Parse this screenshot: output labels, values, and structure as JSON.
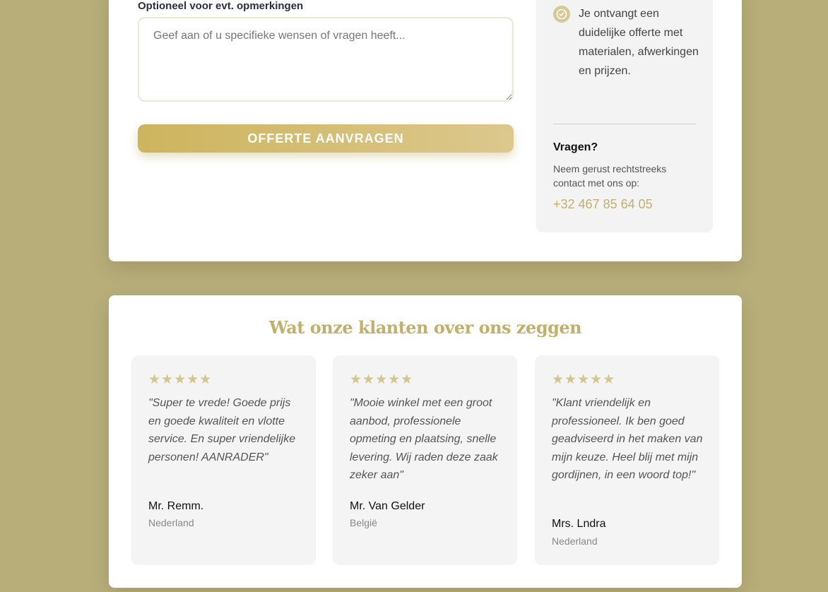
{
  "form": {
    "remarks_label": "Optioneel voor evt. opmerkingen",
    "remarks_placeholder": "Geef aan of u specifieke wensen of vragen heeft...",
    "submit_label": "OFFERTE AANVRAGEN"
  },
  "sidebar": {
    "benefit_text": "Je ontvangt een duidelijke offerte met materialen, afwerkingen en prijzen.",
    "questions_title": "Vragen?",
    "questions_text": "Neem gerust rechtstreeks contact met ons op:",
    "phone": "+32 467 85 64 05",
    "check_icon": "check-circle-icon"
  },
  "reviews": {
    "title": "Wat onze klanten over ons zeggen",
    "items": [
      {
        "stars": "★★★★★",
        "rating": 5,
        "quote": "\"Super te vrede! Goede prijs en goede kwaliteit en vlotte service. En super vriendelijke personen! AANRADER\"",
        "name": "Mr. Remm.",
        "country": "Nederland"
      },
      {
        "stars": "★★★★★",
        "rating": 5,
        "quote": "\"Mooie winkel met een groot aanbod, professionele opmeting en plaatsing, snelle levering. Wij raden deze zaak zeker aan\"",
        "name": "Mr. Van Gelder",
        "country": "België"
      },
      {
        "stars": "★★★★★",
        "rating": 5,
        "quote": "\"Klant vriendelijk en professioneel. Ik ben goed geadviseerd in het maken van mijn keuze. Heel blij met mijn gordijnen, in een woord top!\"",
        "name": "Mrs. Lndra",
        "country": "Nederland"
      }
    ]
  },
  "colors": {
    "background": "#b8ae7a",
    "accent": "#c2b06a",
    "button_gradient_start": "#cdb45e",
    "button_gradient_end": "#dcc88d"
  }
}
